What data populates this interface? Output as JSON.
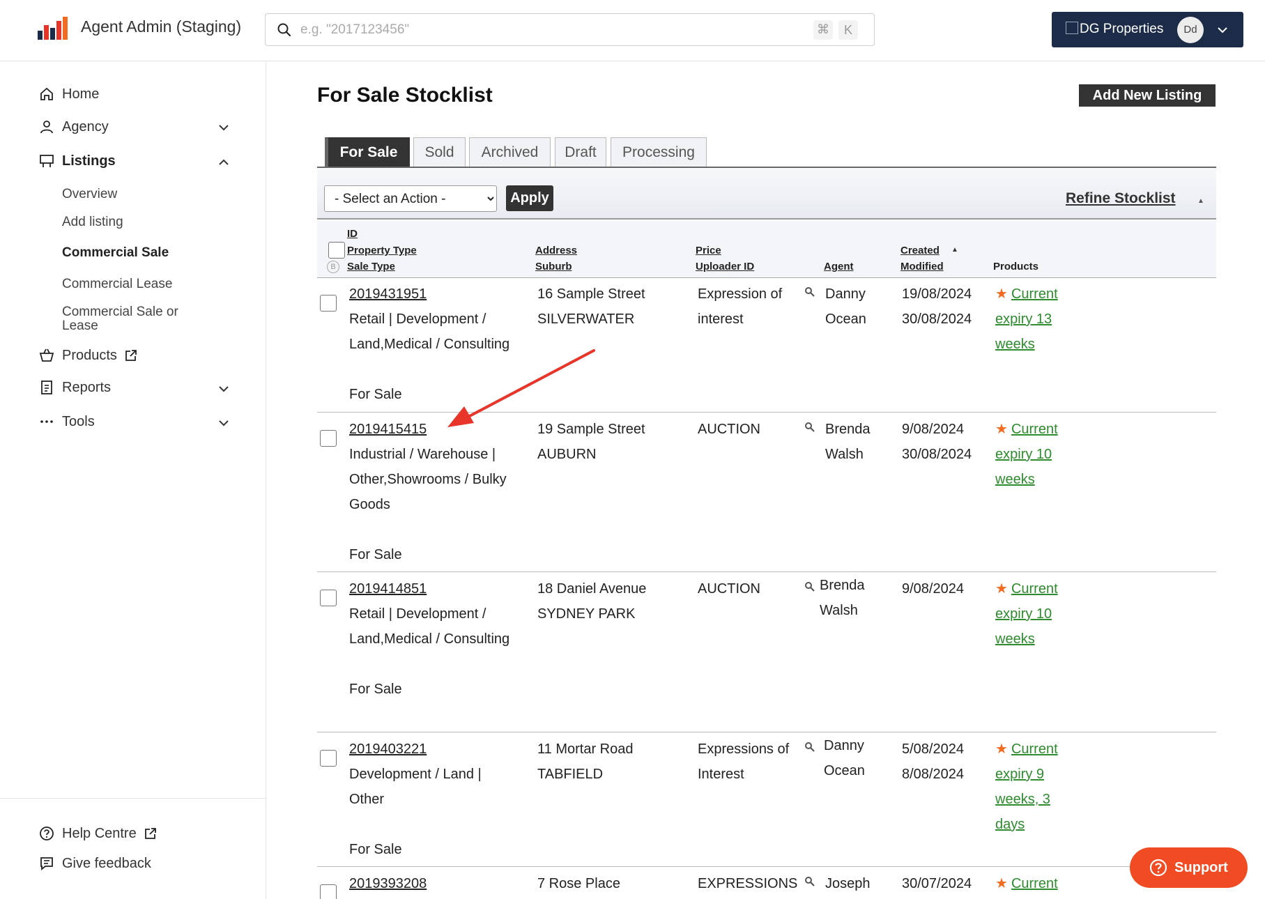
{
  "header": {
    "app_title": "Agent Admin (Staging)",
    "search_placeholder": "e.g. \"2017123456\"",
    "shortcut_cmd": "⌘",
    "shortcut_key": "K",
    "account_name": "DG Properties",
    "avatar_initials": "Dd"
  },
  "sidebar": {
    "home": "Home",
    "agency": "Agency",
    "listings": "Listings",
    "listings_sub": {
      "overview": "Overview",
      "add_listing": "Add listing",
      "commercial_sale": "Commercial Sale",
      "commercial_lease": "Commercial Lease",
      "commercial_sale_or_lease_1": "Commercial Sale or",
      "commercial_sale_or_lease_2": "Lease"
    },
    "products": "Products",
    "reports": "Reports",
    "tools": "Tools",
    "help_centre": "Help Centre",
    "give_feedback": "Give feedback"
  },
  "main": {
    "page_title": "For Sale Stocklist",
    "add_new_listing": "Add New Listing",
    "tabs": [
      "For Sale",
      "Sold",
      "Archived",
      "Draft",
      "Processing"
    ],
    "action_select": "- Select an Action -",
    "apply": "Apply",
    "refine": "Refine Stocklist",
    "headers": {
      "id": "ID",
      "property_type": "Property Type",
      "sale_type": "Sale Type",
      "address": "Address",
      "suburb": "Suburb",
      "price": "Price",
      "uploader_id": "Uploader ID",
      "agent": "Agent",
      "created": "Created",
      "modified": "Modified",
      "products": "Products"
    },
    "rows": [
      {
        "id": "2019431951",
        "type_lines": [
          "Retail | Development /",
          "Land,Medical / Consulting"
        ],
        "sale_type": "For Sale",
        "address": "16 Sample Street",
        "suburb": "SILVERWATER",
        "price_lines": [
          "Expression of",
          "interest"
        ],
        "agent_lines": [
          "Danny",
          "Ocean"
        ],
        "created": "19/08/2024",
        "modified": "30/08/2024",
        "product_lines": [
          "Current",
          "expiry 13",
          "weeks"
        ]
      },
      {
        "id": "2019415415",
        "type_lines": [
          "Industrial / Warehouse |",
          "Other,Showrooms / Bulky",
          "Goods"
        ],
        "sale_type": "For Sale",
        "address": "19 Sample Street",
        "suburb": "AUBURN",
        "price_lines": [
          "AUCTION"
        ],
        "agent_lines": [
          "Brenda",
          "Walsh"
        ],
        "created": "9/08/2024",
        "modified": "30/08/2024",
        "product_lines": [
          "Current",
          "expiry 10",
          "weeks"
        ]
      },
      {
        "id": "2019414851",
        "type_lines": [
          "Retail | Development /",
          "Land,Medical / Consulting"
        ],
        "sale_type": "For Sale",
        "address": "18 Daniel Avenue",
        "suburb": "SYDNEY PARK",
        "price_lines": [
          "AUCTION"
        ],
        "agent_lines": [
          "Brenda",
          "Walsh"
        ],
        "created": "9/08/2024",
        "modified": "",
        "product_lines": [
          "Current",
          "expiry 10",
          "weeks"
        ]
      },
      {
        "id": "2019403221",
        "type_lines": [
          "Development / Land |",
          "Other"
        ],
        "sale_type": "For Sale",
        "address": "11 Mortar Road",
        "suburb": "TABFIELD",
        "price_lines": [
          "Expressions of",
          "Interest"
        ],
        "agent_lines": [
          "Danny",
          "Ocean"
        ],
        "created": "5/08/2024",
        "modified": "8/08/2024",
        "product_lines": [
          "Current",
          "expiry 9",
          "weeks, 3",
          "days"
        ]
      },
      {
        "id": "2019393208",
        "type_lines": [],
        "sale_type": "",
        "address": "7 Rose Place",
        "suburb": "",
        "price_lines": [
          "EXPRESSIONS"
        ],
        "agent_lines": [
          "Joseph"
        ],
        "created": "30/07/2024",
        "modified": "",
        "product_lines": [
          "Current"
        ]
      }
    ]
  },
  "support": "Support",
  "colors": {
    "account_bg": "#1c2b48",
    "support": "#f04b23",
    "product_link": "#2e8b2e",
    "star": "#f26b21",
    "arrow": "#e8352a"
  }
}
